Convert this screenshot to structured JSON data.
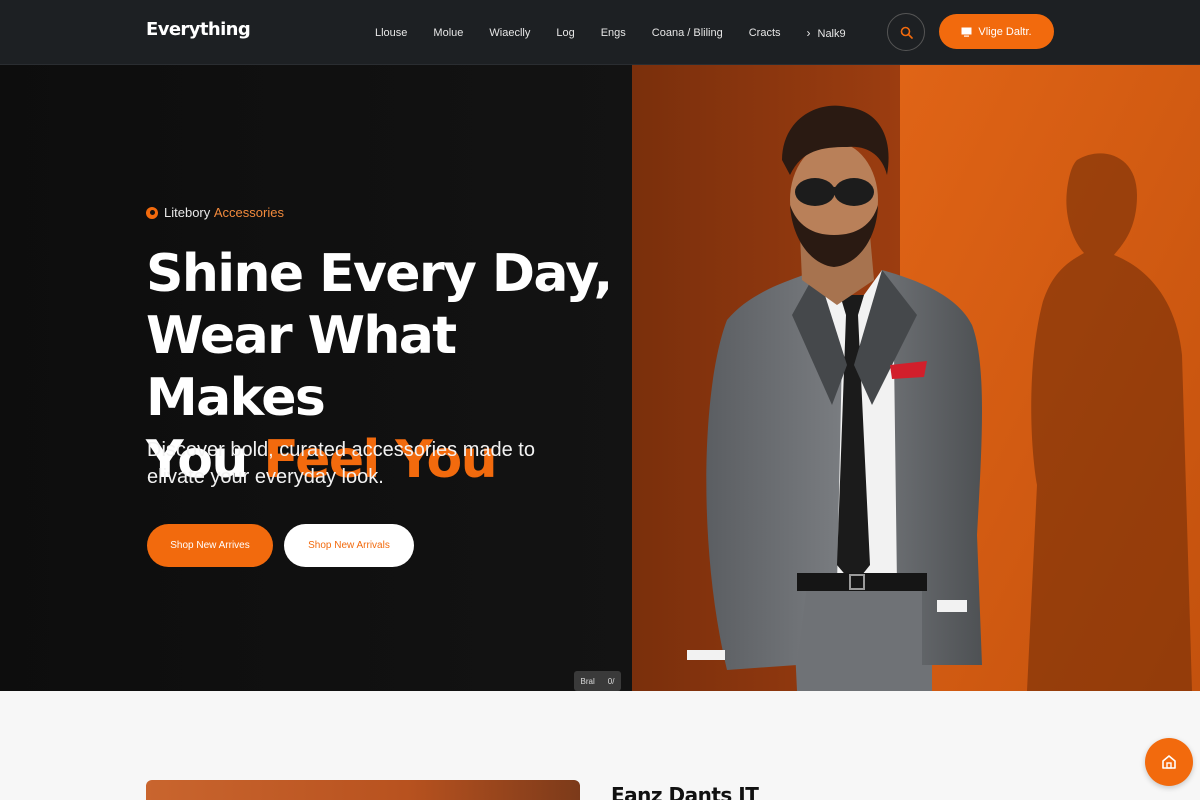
{
  "nav": {
    "logo": "Everything",
    "links": [
      "Llouse",
      "Molue",
      "Wiaeclly",
      "Log",
      "Engs",
      "Coana / Bliling",
      "Cracts",
      "Nalk9"
    ],
    "cta_label": "Vlige Daltr.",
    "search_icon": "search-icon",
    "cta_icon": "monitor-icon"
  },
  "hero": {
    "eyebrow_white": "Litebory",
    "eyebrow_orange": "Accessories",
    "headline_line1": "Shine Every Day,",
    "headline_line2": "Wear What Makes",
    "headline_line3_white": "You",
    "headline_line3_orange": "Feel You",
    "subtext": "Discover bold, curated accessories made to elivate your everyday look.",
    "primary_button": "Shop New Arrives",
    "secondary_button": "Shop New Arrivals",
    "image_tag_left": "Bral",
    "image_tag_right": "0/"
  },
  "section2": {
    "title": "Eanz Dants IT"
  },
  "colors": {
    "accent": "#f26a0d",
    "nav_bg": "#1d2023",
    "hero_bg": "#0f0f0f"
  },
  "floating_button_icon": "home-icon"
}
